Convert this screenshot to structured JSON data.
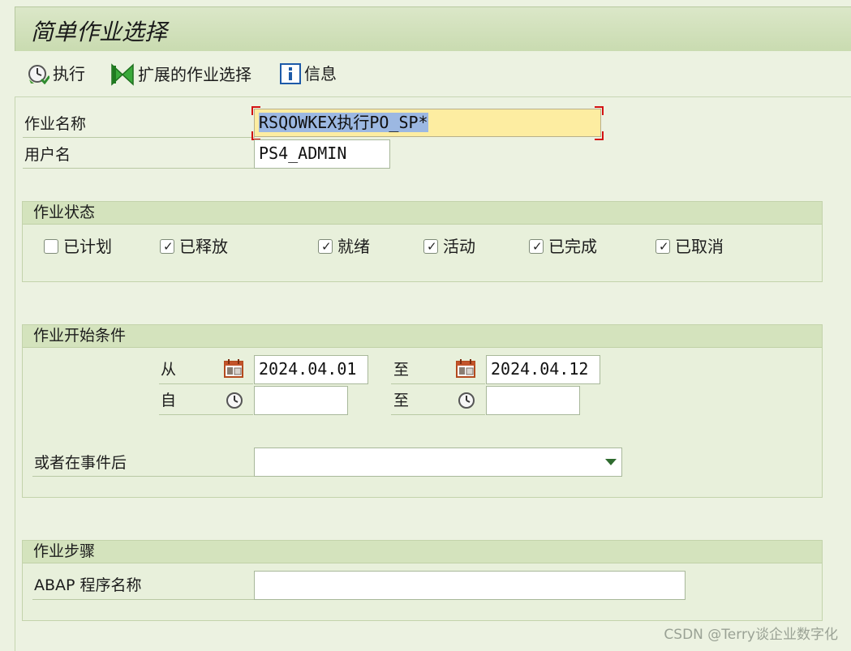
{
  "title": "简单作业选择",
  "toolbar": {
    "execute_label": "执行",
    "extended_label": "扩展的作业选择",
    "info_label": "信息"
  },
  "form": {
    "job_name_label": "作业名称",
    "job_name_value": "RSQOWKEX执行PO_SP*",
    "user_label": "用户名",
    "user_value": "PS4_ADMIN"
  },
  "job_status": {
    "title": "作业状态",
    "items": [
      {
        "label": "已计划",
        "checked": false
      },
      {
        "label": "已释放",
        "checked": true
      },
      {
        "label": "就绪",
        "checked": true
      },
      {
        "label": "活动",
        "checked": true
      },
      {
        "label": "已完成",
        "checked": true
      },
      {
        "label": "已取消",
        "checked": true
      }
    ]
  },
  "job_start": {
    "title": "作业开始条件",
    "from_label": "从",
    "to_label": "至",
    "from_date": "2024.04.01",
    "to_date": "2024.04.12",
    "time_from_label": "自",
    "time_to_label": "至",
    "time_from": "",
    "time_to": "",
    "event_label": "或者在事件后",
    "event_value": ""
  },
  "job_step": {
    "title": "作业步骤",
    "abap_label": "ABAP 程序名称",
    "abap_value": ""
  },
  "watermark": "CSDN @Terry谈企业数字化",
  "check_mark": "✓",
  "icons": {
    "execute": "clock-execute-icon",
    "extended": "bowtie-extended-icon",
    "info": "info-icon",
    "calendar": "calendar-icon",
    "clock": "clock-icon",
    "dropdown": "dropdown-arrow-icon"
  }
}
